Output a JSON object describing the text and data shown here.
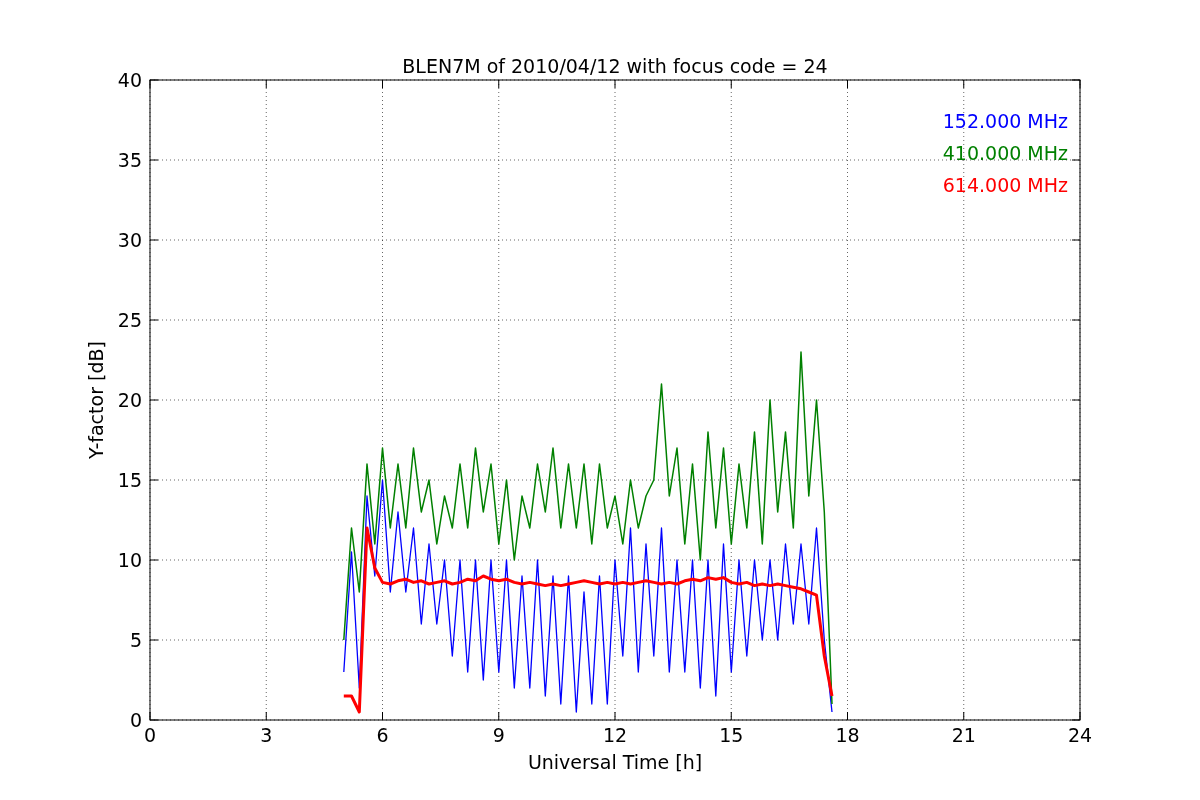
{
  "chart_data": {
    "type": "line",
    "title": "BLEN7M of 2010/04/12 with focus code = 24",
    "xlabel": "Universal Time [h]",
    "ylabel": "Y-factor [dB]",
    "x": [
      5.0,
      5.2,
      5.4,
      5.6,
      5.8,
      6.0,
      6.2,
      6.4,
      6.6,
      6.8,
      7.0,
      7.2,
      7.4,
      7.6,
      7.8,
      8.0,
      8.2,
      8.4,
      8.6,
      8.8,
      9.0,
      9.2,
      9.4,
      9.6,
      9.8,
      10.0,
      10.2,
      10.4,
      10.6,
      10.8,
      11.0,
      11.2,
      11.4,
      11.6,
      11.8,
      12.0,
      12.2,
      12.4,
      12.6,
      12.8,
      13.0,
      13.2,
      13.4,
      13.6,
      13.8,
      14.0,
      14.2,
      14.4,
      14.6,
      14.8,
      15.0,
      15.2,
      15.4,
      15.6,
      15.8,
      16.0,
      16.2,
      16.4,
      16.6,
      16.8,
      17.0,
      17.2,
      17.4,
      17.6
    ],
    "series": [
      {
        "name": "152.000 MHz",
        "color": "#0000ff",
        "values": [
          3,
          10.5,
          2,
          14,
          9,
          15,
          8,
          13,
          8,
          12,
          6,
          11,
          6,
          10,
          4,
          10,
          3,
          10,
          2.5,
          10,
          3,
          10,
          2,
          9,
          2,
          10,
          1.5,
          9,
          1,
          9,
          0.5,
          8,
          1,
          9,
          1,
          10,
          4,
          12,
          3,
          11,
          4,
          12,
          3,
          10,
          3,
          10,
          2,
          10,
          1.5,
          11,
          3,
          10,
          4,
          10,
          5,
          10,
          5,
          11,
          6,
          11,
          6,
          12,
          5,
          0.5
        ]
      },
      {
        "name": "410.000 MHz",
        "color": "#008000",
        "values": [
          5,
          12,
          8,
          16,
          11,
          17,
          12,
          16,
          12,
          17,
          13,
          15,
          11,
          14,
          12,
          16,
          12,
          17,
          13,
          16,
          11,
          15,
          10,
          14,
          12,
          16,
          13,
          17,
          12,
          16,
          12,
          16,
          11,
          16,
          12,
          14,
          11,
          15,
          12,
          14,
          15,
          21,
          14,
          17,
          11,
          16,
          10,
          18,
          12,
          17,
          11,
          16,
          12,
          18,
          11,
          20,
          13,
          18,
          12,
          23,
          14,
          20,
          13,
          1
        ]
      },
      {
        "name": "614.000 MHz",
        "color": "#ff0000",
        "values": [
          1.5,
          1.5,
          0.5,
          12,
          9.5,
          8.6,
          8.5,
          8.7,
          8.8,
          8.6,
          8.7,
          8.5,
          8.6,
          8.7,
          8.5,
          8.6,
          8.8,
          8.7,
          9,
          8.8,
          8.7,
          8.8,
          8.6,
          8.5,
          8.6,
          8.5,
          8.4,
          8.5,
          8.4,
          8.5,
          8.6,
          8.7,
          8.6,
          8.5,
          8.6,
          8.5,
          8.6,
          8.5,
          8.6,
          8.7,
          8.6,
          8.5,
          8.6,
          8.5,
          8.7,
          8.8,
          8.7,
          8.9,
          8.8,
          8.9,
          8.6,
          8.5,
          8.6,
          8.4,
          8.5,
          8.4,
          8.5,
          8.4,
          8.3,
          8.2,
          8,
          7.8,
          4,
          1.5
        ]
      }
    ],
    "xlim": [
      0,
      24
    ],
    "ylim": [
      0,
      40
    ],
    "xticks": [
      0,
      3,
      6,
      9,
      12,
      15,
      18,
      21,
      24
    ],
    "yticks": [
      0,
      5,
      10,
      15,
      20,
      25,
      30,
      35,
      40
    ],
    "grid": true
  }
}
